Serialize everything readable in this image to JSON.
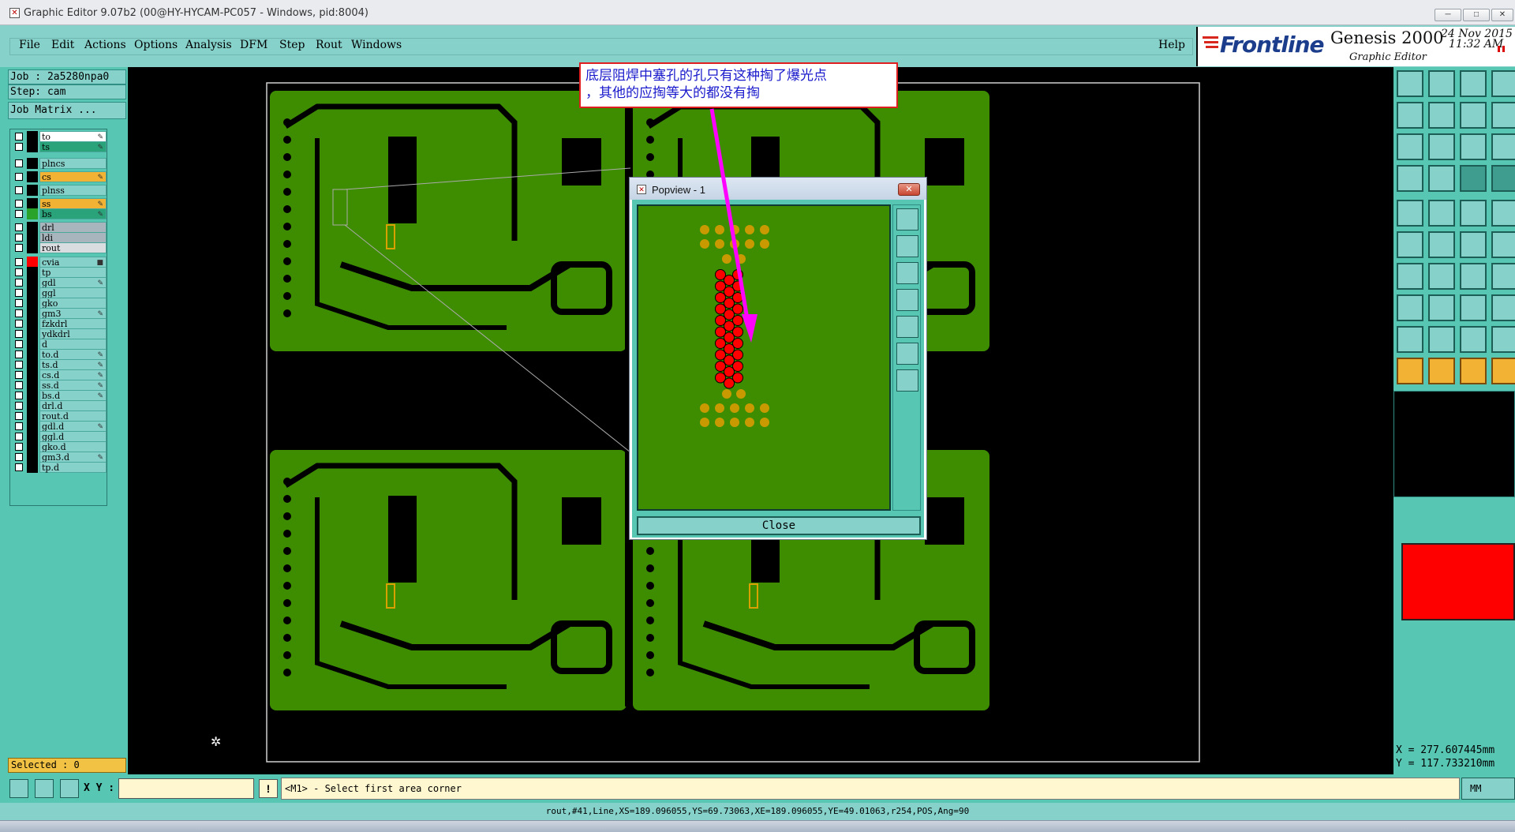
{
  "window": {
    "title": "Graphic Editor 9.07b2 (00@HY-HYCAM-PC057 - Windows, pid:8004)",
    "minimize": "─",
    "maximize": "□",
    "close": "✕"
  },
  "menu": {
    "items": [
      "File",
      "Edit",
      "Actions",
      "Options",
      "Analysis",
      "DFM",
      "Step",
      "Rout",
      "Windows"
    ],
    "help": "Help"
  },
  "logo": {
    "brand": "Frontline",
    "product": "Genesis 2000",
    "date_line1": "24 Nov 2015",
    "date_line2": "11:32 AM",
    "subtitle": "Graphic Editor"
  },
  "job": {
    "job": "Job : 2a5280npa0",
    "step": "Step: cam",
    "matrix_button": "Job Matrix ..."
  },
  "layers": [
    {
      "name": "to",
      "color": "#000000",
      "bg": "#ffffff",
      "mark": "✎"
    },
    {
      "name": "ts",
      "color": "#000000",
      "bg": "#2aa37a",
      "mark": "✎"
    },
    {
      "name": "plncs",
      "color": "#000000",
      "bg": "#86d2cb",
      "mark": ""
    },
    {
      "name": "cs",
      "color": "#000000",
      "bg": "#f2b233",
      "mark": "✎"
    },
    {
      "name": "plnss",
      "color": "#000000",
      "bg": "#86d2cb",
      "mark": ""
    },
    {
      "name": "ss",
      "color": "#000000",
      "bg": "#f2b233",
      "mark": "✎"
    },
    {
      "name": "bs",
      "color": "#2aa32a",
      "bg": "#2aa37a",
      "mark": "✎"
    },
    {
      "name": "drl",
      "color": "#000000",
      "bg": "#a9b5bd",
      "mark": ""
    },
    {
      "name": "ldi",
      "color": "#000000",
      "bg": "#a9b5bd",
      "mark": ""
    },
    {
      "name": "rout",
      "color": "#000000",
      "bg": "#d9dde0",
      "mark": ""
    },
    {
      "name": "cvia",
      "color": "#ff0000",
      "bg": "#86d2cb",
      "mark": "■"
    },
    {
      "name": "tp",
      "color": "#000000",
      "bg": "#86d2cb",
      "mark": ""
    },
    {
      "name": "gdl",
      "color": "#000000",
      "bg": "#86d2cb",
      "mark": "✎"
    },
    {
      "name": "ggl",
      "color": "#000000",
      "bg": "#86d2cb",
      "mark": ""
    },
    {
      "name": "gko",
      "color": "#000000",
      "bg": "#86d2cb",
      "mark": ""
    },
    {
      "name": "gm3",
      "color": "#000000",
      "bg": "#86d2cb",
      "mark": "✎"
    },
    {
      "name": "fzkdrl",
      "color": "#000000",
      "bg": "#86d2cb",
      "mark": ""
    },
    {
      "name": "ydkdrl",
      "color": "#000000",
      "bg": "#86d2cb",
      "mark": ""
    },
    {
      "name": "d",
      "color": "#000000",
      "bg": "#86d2cb",
      "mark": ""
    },
    {
      "name": "to.d",
      "color": "#000000",
      "bg": "#86d2cb",
      "mark": "✎"
    },
    {
      "name": "ts.d",
      "color": "#000000",
      "bg": "#86d2cb",
      "mark": "✎"
    },
    {
      "name": "cs.d",
      "color": "#000000",
      "bg": "#86d2cb",
      "mark": "✎"
    },
    {
      "name": "ss.d",
      "color": "#000000",
      "bg": "#86d2cb",
      "mark": "✎"
    },
    {
      "name": "bs.d",
      "color": "#000000",
      "bg": "#86d2cb",
      "mark": "✎"
    },
    {
      "name": "drl.d",
      "color": "#000000",
      "bg": "#86d2cb",
      "mark": ""
    },
    {
      "name": "rout.d",
      "color": "#000000",
      "bg": "#86d2cb",
      "mark": ""
    },
    {
      "name": "gdl.d",
      "color": "#000000",
      "bg": "#86d2cb",
      "mark": "✎"
    },
    {
      "name": "ggl.d",
      "color": "#000000",
      "bg": "#86d2cb",
      "mark": ""
    },
    {
      "name": "gko.d",
      "color": "#000000",
      "bg": "#86d2cb",
      "mark": ""
    },
    {
      "name": "gm3.d",
      "color": "#000000",
      "bg": "#86d2cb",
      "mark": "✎"
    },
    {
      "name": "tp.d",
      "color": "#000000",
      "bg": "#86d2cb",
      "mark": ""
    }
  ],
  "selected": "Selected : 0",
  "popview": {
    "title": "Popview - 1",
    "close_label": "Close",
    "close_x": "✕"
  },
  "annotation": {
    "line1": "底层阻焊中塞孔的孔只有这种掏了爆光点",
    "line2": "，其他的应掏等大的都没有掏"
  },
  "coords": {
    "x": "X = 277.607445mm",
    "y": "Y = 117.733210mm"
  },
  "command": {
    "xy_label": "X Y :",
    "xy_value": "",
    "info": "!",
    "prompt": "<M1> - Select first area corner",
    "units": "MM"
  },
  "status": "rout,#41,Line,XS=189.096055,YS=69.73063,XE=189.096055,YE=49.01063,r254,POS,Ang=90",
  "colors": {
    "panel": "#57c7b4",
    "panel_light": "#86d2cb",
    "board": "#3e8d00",
    "highlight": "#ff0000",
    "annotation_arrow": "#ff00ff"
  }
}
